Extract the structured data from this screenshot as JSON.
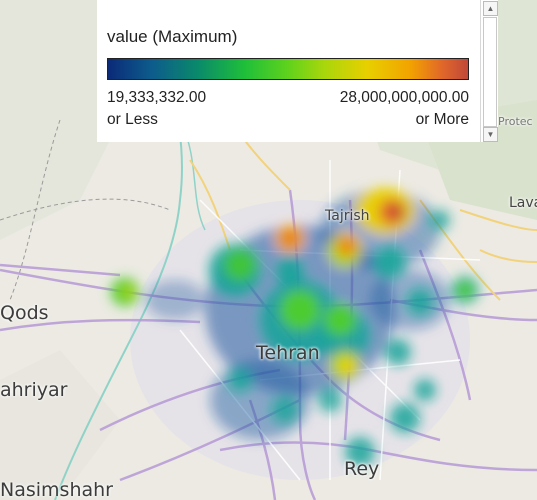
{
  "legend": {
    "title": "value (Maximum)",
    "min_value": "19,333,332.00",
    "min_caption": "or Less",
    "max_value": "28,000,000,000.00",
    "max_caption": "or More",
    "scroll_up": "▲",
    "scroll_down": "▼"
  },
  "places": {
    "tehran": "Tehran",
    "tajrish": "Tajrish",
    "qods": "Qods",
    "shahriyar": "ahriyar",
    "nasimshahr": "Nasimshahr",
    "rey": "Rey",
    "lavasan": "Lava",
    "protected": "Protec"
  },
  "colors": {
    "gradient_low": "#0b2a78",
    "gradient_mid": "#5fd21c",
    "gradient_high": "#c04838"
  }
}
